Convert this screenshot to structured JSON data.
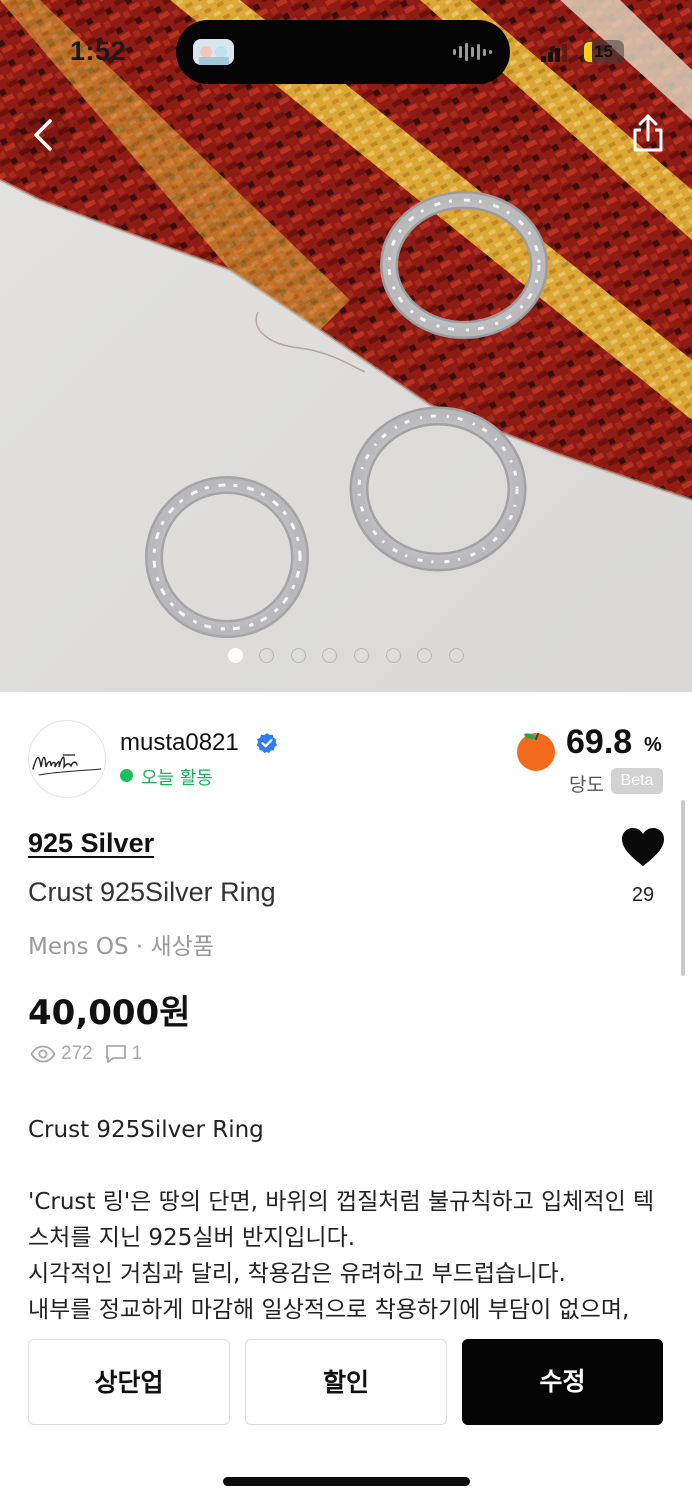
{
  "status_bar": {
    "time": "1:52",
    "battery": "15"
  },
  "gallery": {
    "image_count": 8,
    "active_index": 0
  },
  "seller": {
    "name": "musta0821",
    "activity": "오늘 활동",
    "temperature_value": "69.8",
    "temperature_unit": "%",
    "temperature_label": "당도",
    "beta_badge": "Beta"
  },
  "product": {
    "brand": "925 Silver",
    "title": "Crust 925Silver Ring",
    "meta": "Mens OS · 새상품",
    "price": "40,000원",
    "likes": "29",
    "views": "272",
    "comments": "1"
  },
  "description": {
    "lines": [
      "Crust 925Silver Ring",
      "",
      "'Crust 링'은 땅의 단면, 바위의 껍질처럼 불규칙하고 입체적인 텍",
      "스처를 지닌 925실버 반지입니다.",
      "시각적인 거침과 달리, 착용감은 유려하고 부드럽습니다.",
      "내부를 정교하게 마감해 일상적으로 착용하기에 부담이 없으며,"
    ]
  },
  "actions": {
    "bump_label": "상단업",
    "discount_label": "할인",
    "edit_label": "수정"
  },
  "colors": {
    "accent_green": "#19c05b",
    "verified_blue": "#2f7df6",
    "primary_button": "#050505",
    "temperature_orange": "#f26a1b"
  },
  "icons": {
    "back": "chevron-left-icon",
    "share": "share-icon",
    "verified": "verified-badge-icon",
    "temperature": "orange-fruit-icon",
    "like": "heart-icon",
    "views": "eye-icon",
    "comments": "chat-bubble-icon"
  }
}
